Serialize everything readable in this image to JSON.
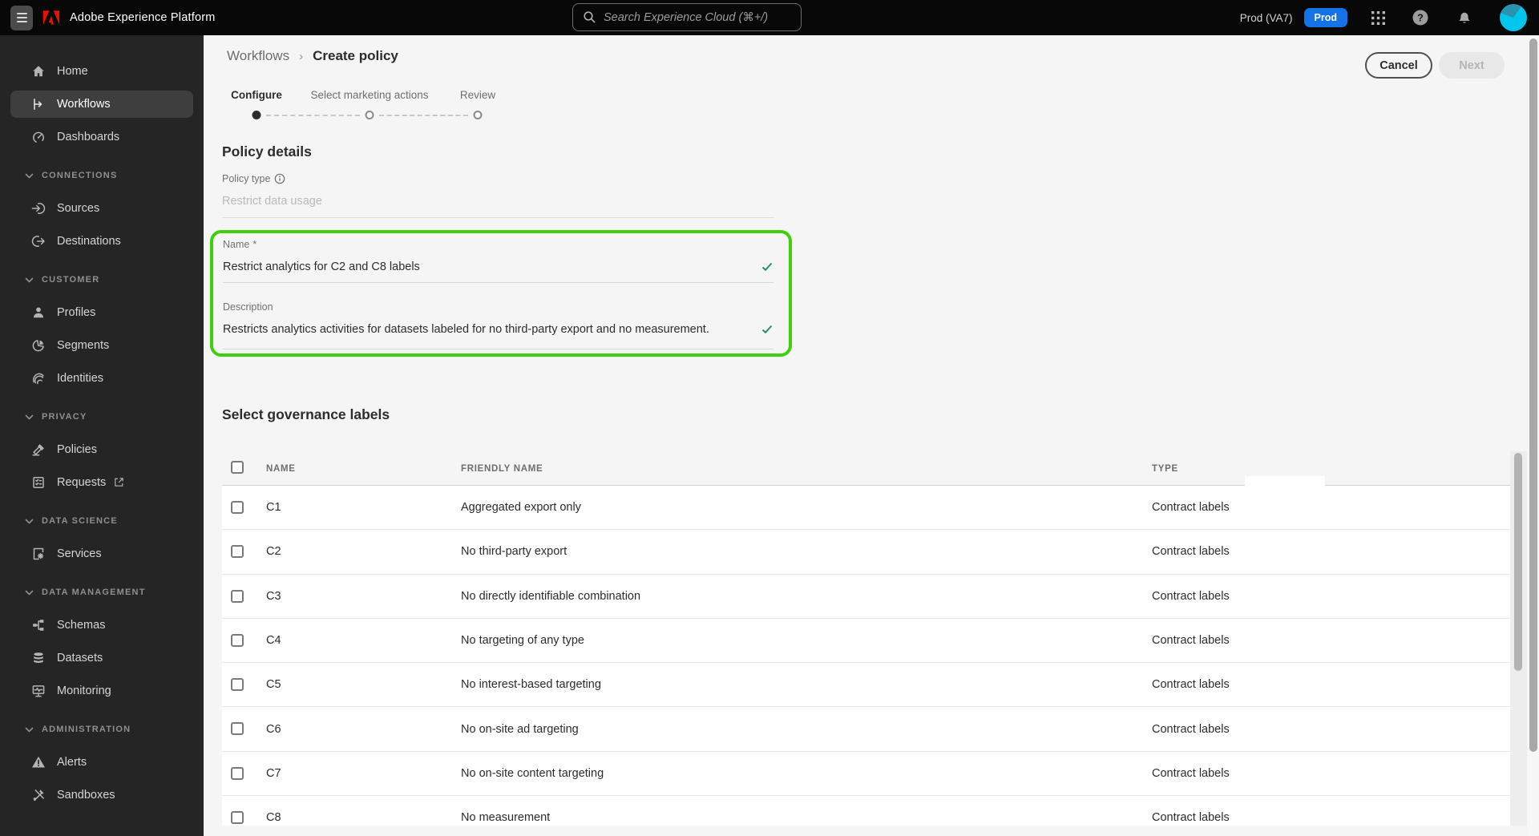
{
  "topbar": {
    "app_title": "Adobe Experience Platform",
    "search_placeholder": "Search Experience Cloud (⌘+/)",
    "environment": "Prod (VA7)",
    "environment_badge": "Prod"
  },
  "sidebar": {
    "groups": [
      {
        "header": null,
        "items": [
          {
            "label": "Home",
            "icon": "home",
            "selected": false
          },
          {
            "label": "Workflows",
            "icon": "workflows",
            "selected": true
          },
          {
            "label": "Dashboards",
            "icon": "dashboards",
            "selected": false
          }
        ]
      },
      {
        "header": "CONNECTIONS",
        "items": [
          {
            "label": "Sources",
            "icon": "sources"
          },
          {
            "label": "Destinations",
            "icon": "destinations"
          }
        ]
      },
      {
        "header": "CUSTOMER",
        "items": [
          {
            "label": "Profiles",
            "icon": "profiles"
          },
          {
            "label": "Segments",
            "icon": "segments"
          },
          {
            "label": "Identities",
            "icon": "identities"
          }
        ]
      },
      {
        "header": "PRIVACY",
        "items": [
          {
            "label": "Policies",
            "icon": "policies"
          },
          {
            "label": "Requests",
            "icon": "requests",
            "external": true
          }
        ]
      },
      {
        "header": "DATA SCIENCE",
        "items": [
          {
            "label": "Services",
            "icon": "services"
          }
        ]
      },
      {
        "header": "DATA MANAGEMENT",
        "items": [
          {
            "label": "Schemas",
            "icon": "schemas"
          },
          {
            "label": "Datasets",
            "icon": "datasets"
          },
          {
            "label": "Monitoring",
            "icon": "monitoring"
          }
        ]
      },
      {
        "header": "ADMINISTRATION",
        "items": [
          {
            "label": "Alerts",
            "icon": "alerts"
          },
          {
            "label": "Sandboxes",
            "icon": "sandboxes"
          }
        ]
      }
    ]
  },
  "breadcrumb": {
    "parent": "Workflows",
    "current": "Create policy"
  },
  "actions": {
    "cancel": "Cancel",
    "next": "Next"
  },
  "stepper": {
    "steps": [
      {
        "label": "Configure",
        "state": "current"
      },
      {
        "label": "Select marketing actions",
        "state": "upcoming"
      },
      {
        "label": "Review",
        "state": "upcoming"
      }
    ]
  },
  "policy_details": {
    "heading": "Policy details",
    "policy_type_label": "Policy type",
    "policy_type_value": "Restrict data usage",
    "name_label": "Name",
    "required_marker": "*",
    "name_value": "Restrict analytics for C2 and C8 labels",
    "description_label": "Description",
    "description_value": "Restricts analytics activities for datasets labeled for no third-party export and no measurement."
  },
  "governance": {
    "heading": "Select governance labels",
    "columns": {
      "name": "NAME",
      "friendly_name": "FRIENDLY NAME",
      "type": "TYPE"
    },
    "rows": [
      {
        "name": "C1",
        "friendly_name": "Aggregated export only",
        "type": "Contract labels",
        "checked": false
      },
      {
        "name": "C2",
        "friendly_name": "No third-party export",
        "type": "Contract labels",
        "checked": false
      },
      {
        "name": "C3",
        "friendly_name": "No directly identifiable combination",
        "type": "Contract labels",
        "checked": false
      },
      {
        "name": "C4",
        "friendly_name": "No targeting of any type",
        "type": "Contract labels",
        "checked": false
      },
      {
        "name": "C5",
        "friendly_name": "No interest-based targeting",
        "type": "Contract labels",
        "checked": false
      },
      {
        "name": "C6",
        "friendly_name": "No on-site ad targeting",
        "type": "Contract labels",
        "checked": false
      },
      {
        "name": "C7",
        "friendly_name": "No on-site content targeting",
        "type": "Contract labels",
        "checked": false
      },
      {
        "name": "C8",
        "friendly_name": "No measurement",
        "type": "Contract labels",
        "checked": false
      }
    ]
  },
  "colors": {
    "accent_green": "#3ed10b",
    "success_check": "#268e6c",
    "badge_blue": "#1473e6",
    "topbar_bg": "#080808",
    "sidebar_bg": "#252525"
  }
}
